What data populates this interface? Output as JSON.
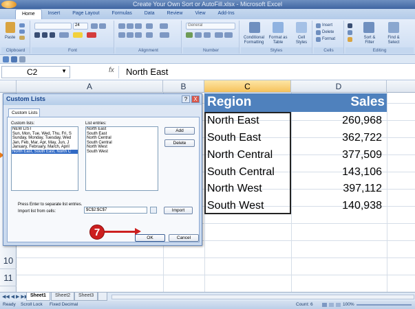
{
  "window": {
    "title": "Create Your Own Sort or AutoFill.xlsx - Microsoft Excel"
  },
  "ribbon": {
    "tabs": [
      "Home",
      "Insert",
      "Page Layout",
      "Formulas",
      "Data",
      "Review",
      "View",
      "Add-Ins"
    ],
    "active_tab": "Home",
    "font_size": "24",
    "number_format": "General",
    "groups": [
      "Clipboard",
      "Font",
      "Alignment",
      "Number",
      "Styles",
      "Cells",
      "Editing"
    ],
    "buttons": {
      "paste": "Paste",
      "conditional": "Conditional Formatting",
      "format_table": "Format as Table",
      "cell_styles": "Cell Styles",
      "insert": "Insert",
      "delete": "Delete",
      "format": "Format",
      "sort_filter": "Sort & Filter",
      "find_select": "Find & Select"
    }
  },
  "formula_bar": {
    "name_box": "C2",
    "fx": "fx",
    "content": "North East"
  },
  "sheet": {
    "columns": [
      "A",
      "B",
      "C",
      "D"
    ],
    "rows": [
      "10",
      "11"
    ],
    "header": {
      "region": "Region",
      "sales": "Sales"
    },
    "data": [
      {
        "region": "North East",
        "sales": "260,968"
      },
      {
        "region": "South East",
        "sales": "362,722"
      },
      {
        "region": "North Central",
        "sales": "377,509"
      },
      {
        "region": "South Central",
        "sales": "143,106"
      },
      {
        "region": "North West",
        "sales": "397,112"
      },
      {
        "region": "South West",
        "sales": "140,938"
      }
    ]
  },
  "dialog": {
    "title": "Custom Lists",
    "help": "?",
    "close": "X",
    "tab": "Custom Lists",
    "custom_lists_label": "Custom lists:",
    "custom_lists": [
      "NEW LIST",
      "Sun, Mon, Tue, Wed, Thu, Fri, S",
      "Sunday, Monday, Tuesday, Wed",
      "Jan, Feb, Mar, Apr, May, Jun, J",
      "January, February, March, April",
      "North East, South East, North C"
    ],
    "selected_index": 5,
    "list_entries_label": "List entries:",
    "list_entries": [
      "North East",
      "South East",
      "North Central",
      "South Central",
      "North West",
      "South West"
    ],
    "add": "Add",
    "delete": "Delete",
    "hint": "Press Enter to separate list entries.",
    "import_label": "Import list from cells:",
    "import_value": "$C$2:$C$7",
    "import_btn": "Import",
    "ok": "OK",
    "cancel": "Cancel"
  },
  "step": "7",
  "sheet_tabs": [
    "Sheet1",
    "Sheet2",
    "Sheet3"
  ],
  "active_sheet": "Sheet1",
  "status": {
    "ready": "Ready",
    "scroll_lock": "Scroll Lock",
    "fixed_decimal": "Fixed Decimal",
    "count": "Count: 6",
    "zoom": "100%"
  }
}
